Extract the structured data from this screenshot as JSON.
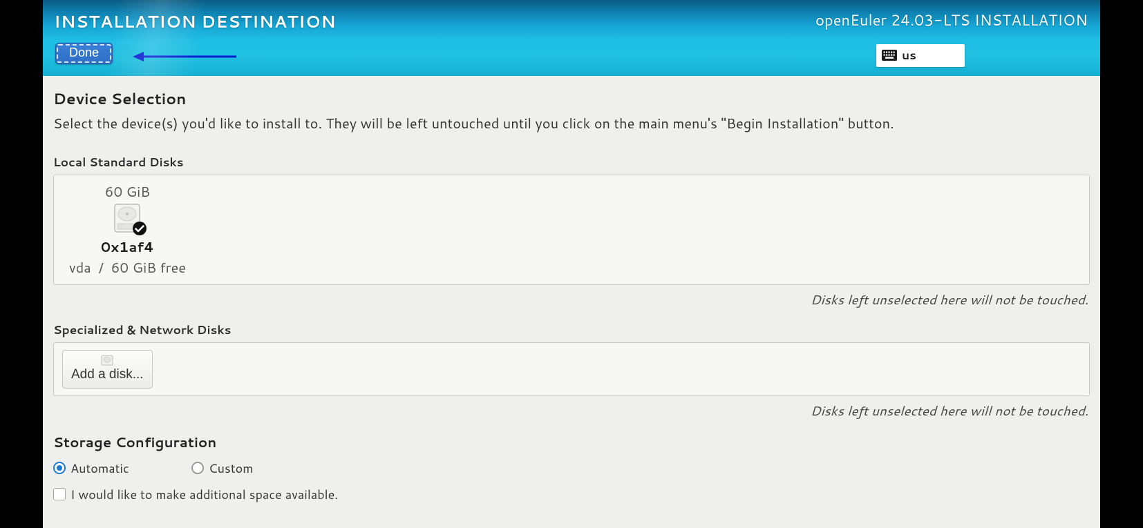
{
  "header": {
    "page_title": "INSTALLATION DESTINATION",
    "done_label": "Done",
    "product_line": "openEuler 24.03-LTS INSTALLATION",
    "keyboard_layout": "us"
  },
  "device_selection": {
    "title": "Device Selection",
    "help_text": "Select the device(s) you'd like to install to.  They will be left untouched until you click on the main menu's \"Begin Installation\" button."
  },
  "local_disks": {
    "label": "Local Standard Disks",
    "hint": "Disks left unselected here will not be touched.",
    "items": [
      {
        "size": "60 GiB",
        "model": "0x1af4",
        "device": "vda",
        "free": "60 GiB free",
        "selected": true
      }
    ]
  },
  "special_disks": {
    "label": "Specialized & Network Disks",
    "add_disk_label": "Add a disk...",
    "hint": "Disks left unselected here will not be touched."
  },
  "storage_config": {
    "title": "Storage Configuration",
    "options": [
      {
        "id": "automatic",
        "label": "Automatic",
        "selected": true
      },
      {
        "id": "custom",
        "label": "Custom",
        "selected": false
      }
    ],
    "reclaim_checkbox": {
      "label": "I would like to make additional space available.",
      "checked": false
    }
  }
}
